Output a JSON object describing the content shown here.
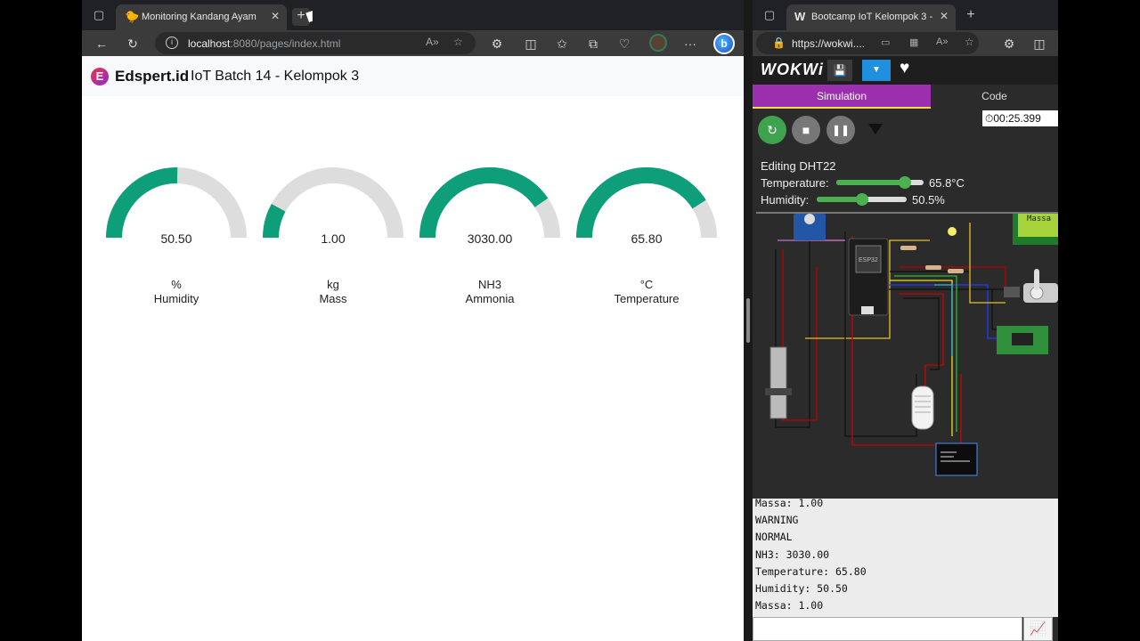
{
  "left_browser": {
    "tab_title": "Monitoring Kandang Ayam",
    "tab_icon": "chick-icon",
    "url_host": "localhost",
    "url_rest": ":8080/pages/index.html"
  },
  "page": {
    "brand": "Edspert.id",
    "title": "IoT Batch 14 - Kelompok 3",
    "gauge_color": "#0e9e7a",
    "gauge_track": "#dddddd",
    "gauges": [
      {
        "value_text": "50.50",
        "unit": "%",
        "label": "Humidity",
        "fraction": 0.505
      },
      {
        "value_text": "1.00",
        "unit": "kg",
        "label": "Mass",
        "fraction": 0.16
      },
      {
        "value_text": "3030.00",
        "unit": "NH3",
        "label": "Ammonia",
        "fraction": 0.81
      },
      {
        "value_text": "65.80",
        "unit": "°C",
        "label": "Temperature",
        "fraction": 0.82
      }
    ]
  },
  "right_browser": {
    "tab_title": "Bootcamp IoT Kelompok 3 - W",
    "url": "https://wokwi...."
  },
  "wokwi": {
    "logo": "WOKWi",
    "tab_simulation": "Simulation",
    "tab_code": "Code",
    "timer": "00:25.399",
    "editing_title": "Editing DHT22",
    "temperature_label": "Temperature:",
    "temperature_value": "65.8°C",
    "temperature_fraction": 0.79,
    "humidity_label": "Humidity:",
    "humidity_value": "50.5%",
    "humidity_fraction": 0.505,
    "canvas_labels": {
      "esp32": "ESP32",
      "lcd": "Massa"
    },
    "serial_lines": [
      "Massa: 1.00",
      "WARNING",
      "NORMAL",
      "NH3: 3030.00",
      "Temperature: 65.80",
      "Humidity: 50.50",
      "Massa: 1.00"
    ]
  }
}
